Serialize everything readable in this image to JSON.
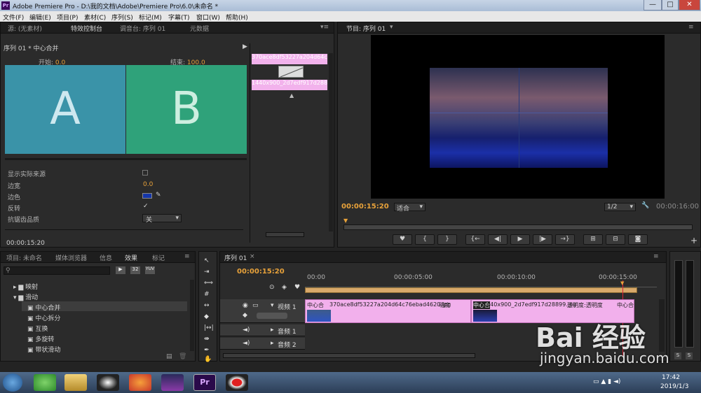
{
  "window": {
    "title": "Adobe Premiere Pro - D:\\我的文档\\Adobe\\Premiere Pro\\6.0\\未命名 *",
    "app_icon": "Pr",
    "min": "—",
    "max": "□",
    "close": "✕"
  },
  "menu": [
    "文件(F)",
    "编辑(E)",
    "项目(P)",
    "素材(C)",
    "序列(S)",
    "标记(M)",
    "字幕(T)",
    "窗口(W)",
    "帮助(H)"
  ],
  "top_left_tabs": [
    "源: (无素材)",
    "特效控制台",
    "调音台: 序列 01",
    "元数据"
  ],
  "effect_controls": {
    "header": "序列 01 * 中心合并",
    "start_label": "开始:",
    "start_value": "0.0",
    "end_label": "结束:",
    "end_value": "100.0",
    "preview_a": "A",
    "preview_b": "B",
    "clip1_name": "370ace8df53227a204d64c76",
    "clip2_name": "1440x900_2d7edf917d28899",
    "props": [
      {
        "label": "显示实际来源",
        "value": ""
      },
      {
        "label": "边宽",
        "value": "0.0"
      },
      {
        "label": "边色",
        "value": ""
      },
      {
        "label": "反转",
        "value": "✓"
      },
      {
        "label": "抗锯齿品质",
        "value": "关"
      }
    ],
    "timecode": "00:00:15:20"
  },
  "program": {
    "tab": "节目: 序列 01",
    "timecode": "00:00:15:20",
    "fit": "适合",
    "resolution": "1/2",
    "duration": "00:00:16:00"
  },
  "project_tabs": [
    "项目: 未命名",
    "媒体浏览器",
    "信息",
    "效果",
    "标记"
  ],
  "effects_tree": [
    "映射",
    "滑动",
    "中心合并",
    "中心拆分",
    "互换",
    "多旋转",
    "带状滑动"
  ],
  "timeline": {
    "tab": "序列 01",
    "timecode": "00:00:15:20",
    "ruler": [
      "00:00",
      "00:00:05:00",
      "00:00:10:00",
      "00:00:15:00"
    ],
    "tracks": [
      {
        "label": "视频 1"
      },
      {
        "label": "音频 1"
      },
      {
        "label": "音频 2"
      }
    ],
    "clip1": "中心合",
    "clip1_file": "370ace8df53227a204d64c76ebad4620.jpg",
    "clip1_opacity": "明度",
    "clip2": "中心合",
    "clip2_file": "1440x900_2d7edf917d28899.jpg",
    "clip2_opacity": "透明度:透明度",
    "clip3": "中心合"
  },
  "taskbar": {
    "time": "17:42",
    "date": "2019/1/3"
  },
  "watermark": {
    "brand": "Bai 经验",
    "url": "jingyan.baidu.com"
  }
}
